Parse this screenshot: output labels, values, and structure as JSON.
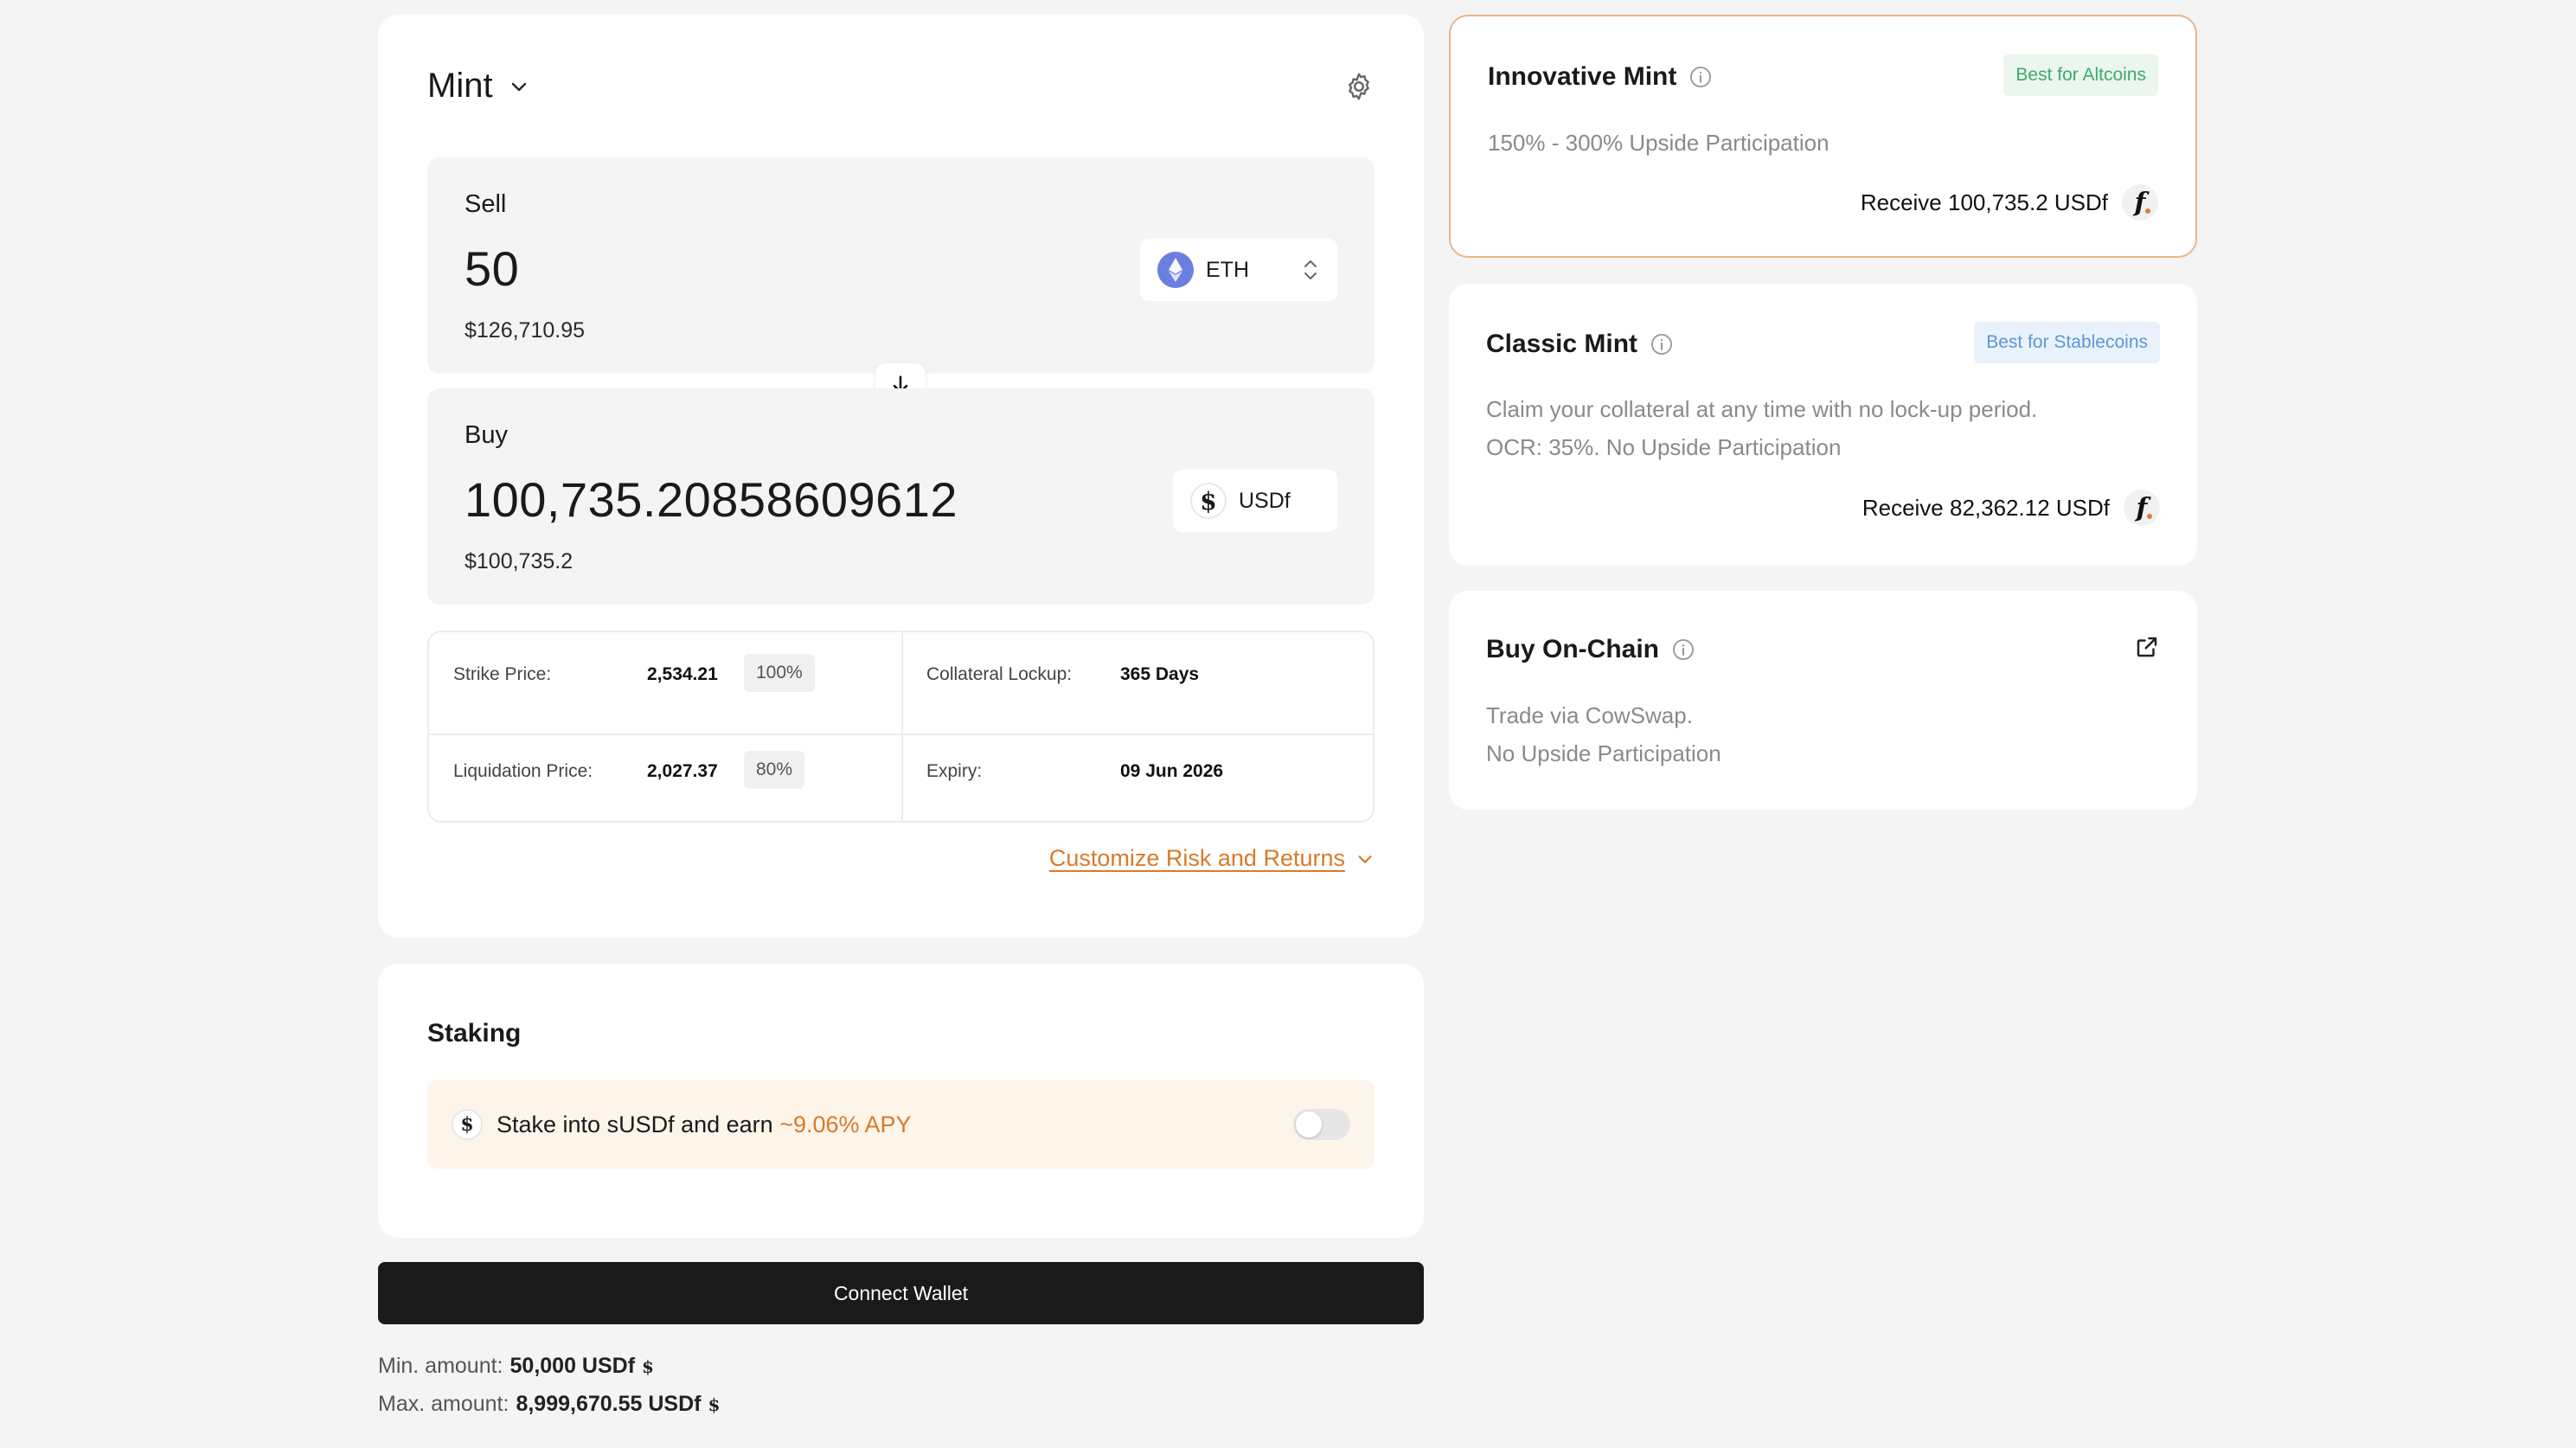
{
  "mint": {
    "title": "Mint",
    "sell": {
      "label": "Sell",
      "amount": "50",
      "usd": "$126,710.95",
      "token": "ETH"
    },
    "buy": {
      "label": "Buy",
      "amount": "100,735.20858609612",
      "usd": "$100,735.2",
      "token": "USDf"
    },
    "details": {
      "strike_label": "Strike Price:",
      "strike_value": "2,534.21",
      "strike_pct": "100%",
      "lockup_label": "Collateral Lockup:",
      "lockup_value": "365 Days",
      "liq_label": "Liquidation Price:",
      "liq_value": "2,027.37",
      "liq_pct": "80%",
      "expiry_label": "Expiry:",
      "expiry_value": "09 Jun 2026"
    },
    "customize_label": "Customize Risk and Returns"
  },
  "staking": {
    "title": "Staking",
    "text": "Stake into sUSDf and earn",
    "apy": "~9.06% APY",
    "enabled": false
  },
  "connect_label": "Connect Wallet",
  "limits": {
    "min_label": "Min. amount:",
    "min_value": "50,000 USDf",
    "max_label": "Max. amount:",
    "max_value": "8,999,670.55 USDf"
  },
  "options": {
    "innovative": {
      "title": "Innovative Mint",
      "badge": "Best for Altcoins",
      "desc": "150% - 300% Upside Participation",
      "receive": "Receive 100,735.2 USDf"
    },
    "classic": {
      "title": "Classic Mint",
      "badge": "Best for Stablecoins",
      "desc1": "Claim your collateral at any time with no lock-up period.",
      "desc2": "OCR: 35%. No Upside Participation",
      "receive": "Receive 82,362.12 USDf"
    },
    "onchain": {
      "title": "Buy On-Chain",
      "desc1": "Trade via CowSwap.",
      "desc2": "No Upside Participation"
    }
  },
  "colors": {
    "accent": "#d97a2a",
    "badge_green": "#3eaa6a",
    "badge_blue": "#5c97d6",
    "eth": "#6b7fe0"
  },
  "icons": [
    "chevron-down-icon",
    "gear-icon",
    "eth-icon",
    "usdf-icon",
    "sort-icon",
    "arrow-down-icon",
    "info-icon",
    "external-link-icon",
    "f-icon"
  ]
}
